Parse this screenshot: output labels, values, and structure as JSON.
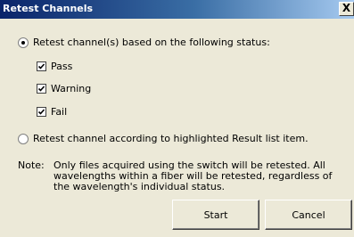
{
  "window": {
    "title": "Retest Channels",
    "close_glyph": "X"
  },
  "option_status": {
    "label": "Retest channel(s) based on the following status:",
    "selected": true,
    "checks": [
      {
        "label": "Pass",
        "checked": true
      },
      {
        "label": "Warning",
        "checked": true
      },
      {
        "label": "Fail",
        "checked": true
      }
    ]
  },
  "option_highlighted": {
    "label": "Retest channel according to highlighted Result list item.",
    "selected": false
  },
  "note": {
    "label": "Note:",
    "text": "Only files acquired using the switch will be retested. All wavelengths within a fiber will be retested, regardless of the wavelength's individual status."
  },
  "buttons": {
    "start": "Start",
    "cancel": "Cancel"
  }
}
